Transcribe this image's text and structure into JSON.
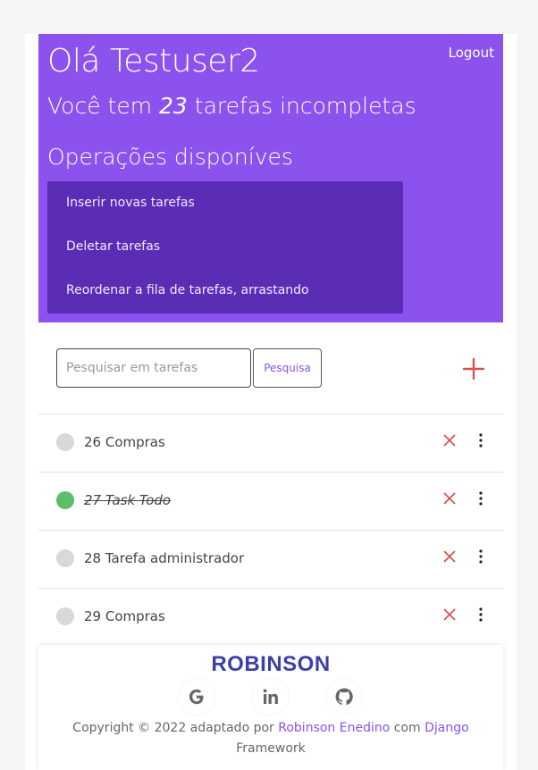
{
  "header": {
    "greeting": "Olá Testuser2",
    "logout_label": "Logout",
    "subtitle_prefix": "Você tem ",
    "incomplete_count": "23",
    "subtitle_suffix": " tarefas incompletas",
    "operations_title": "Operações disponíves",
    "operations": [
      "Inserir novas tarefas",
      "Deletar tarefas",
      "Reordenar a fila de tarefas, arrastando"
    ]
  },
  "search": {
    "placeholder": "Pesquisar em tarefas",
    "value": "",
    "button_label": "Pesquisa"
  },
  "tasks": [
    {
      "label": "26 Compras",
      "done": false
    },
    {
      "label": "27 Task Todo",
      "done": true
    },
    {
      "label": "28 Tarefa administrador",
      "done": false
    },
    {
      "label": "29 Compras",
      "done": false
    }
  ],
  "footer": {
    "brand": "ROBINSON",
    "social_icons": [
      "google-icon",
      "linkedin-icon",
      "github-icon"
    ],
    "copyright_prefix": "Copyright © 2022 adaptado por ",
    "author_link": "Robinson Enedino",
    "copyright_mid": " com ",
    "framework_link": "Django",
    "copyright_suffix": "Framework"
  },
  "colors": {
    "accent": "#8b52ee",
    "operations_bg": "#5b2db5",
    "done_status": "#5cbd6a",
    "pending_status": "#d8d8d8",
    "delete": "#d9534f",
    "add": "#d9534f",
    "brand": "#3b3fa8"
  }
}
